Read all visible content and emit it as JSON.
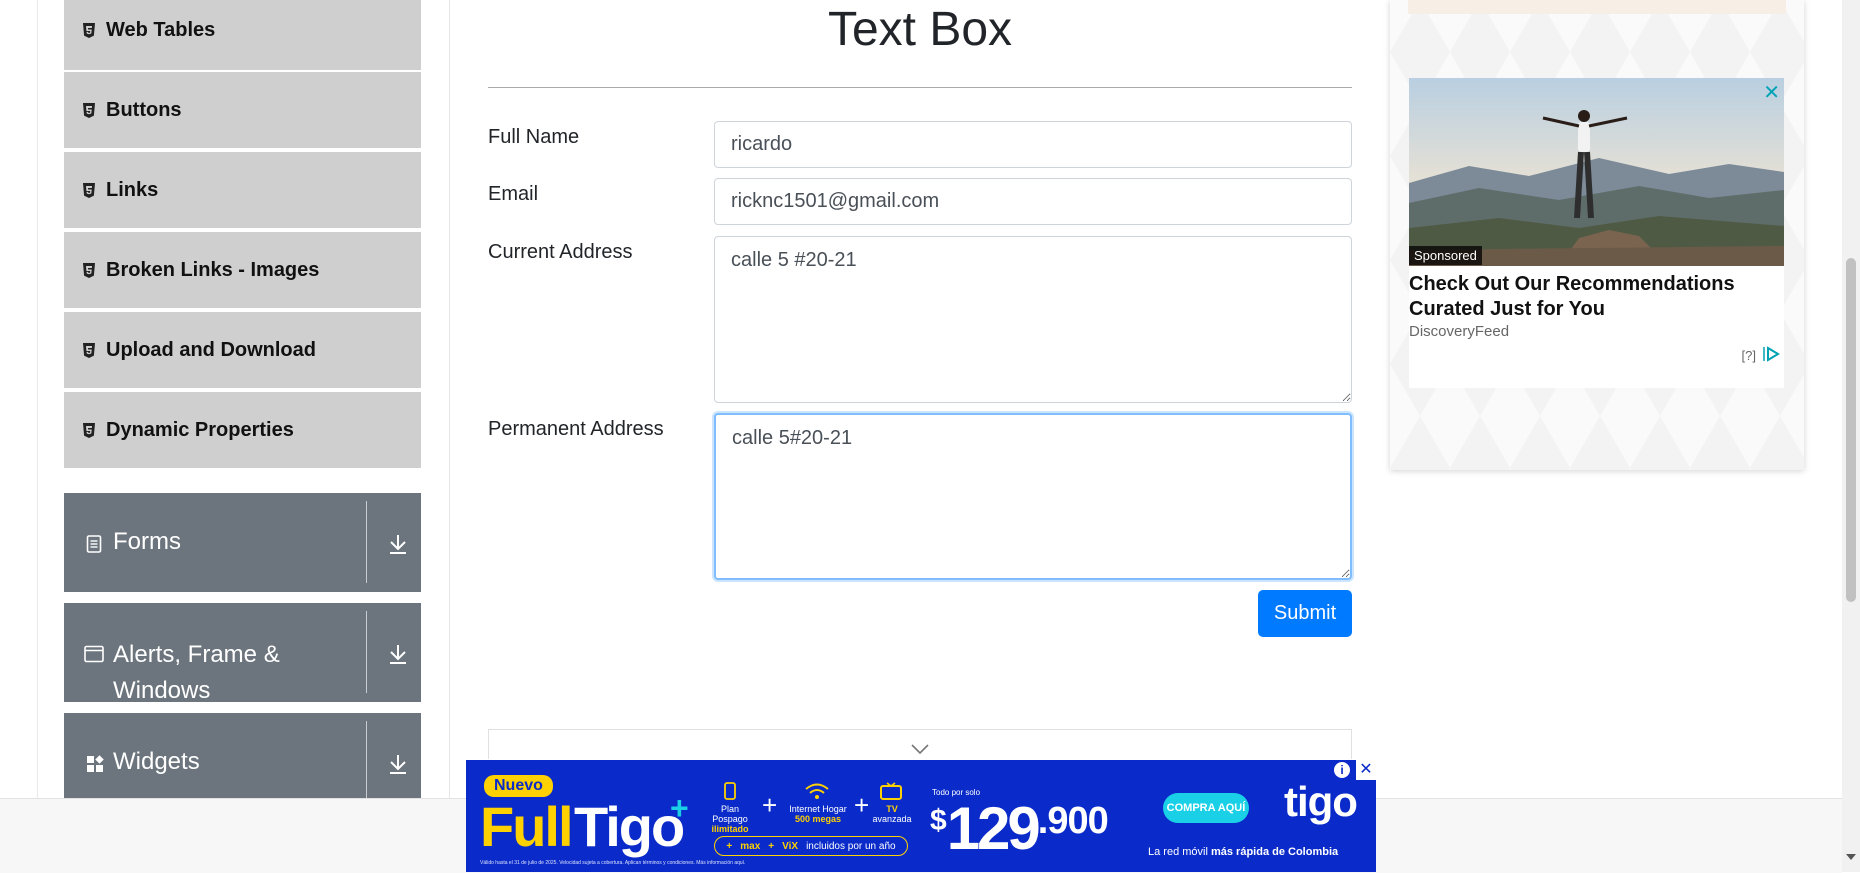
{
  "sidebar": {
    "sub_items": [
      {
        "label": "Web Tables"
      },
      {
        "label": "Buttons"
      },
      {
        "label": "Links"
      },
      {
        "label": "Broken Links - Images"
      },
      {
        "label": "Upload and Download"
      },
      {
        "label": "Dynamic Properties"
      }
    ],
    "groups": [
      {
        "label": "Forms",
        "icon": "document-icon"
      },
      {
        "label_line1": "Alerts, Frame &",
        "label_line2": "Windows",
        "icon": "window-icon"
      },
      {
        "label": "Widgets",
        "icon": "widgets-icon"
      }
    ]
  },
  "main": {
    "title": "Text Box",
    "fields": {
      "full_name": {
        "label": "Full Name",
        "value": "ricardo"
      },
      "email": {
        "label": "Email",
        "value": "ricknc1501@gmail.com"
      },
      "current_address": {
        "label": "Current Address",
        "value": "calle 5 #20-21"
      },
      "permanent_address": {
        "label": "Permanent Address",
        "value": "calle 5#20-21"
      }
    },
    "submit_label": "Submit"
  },
  "right_ad": {
    "sponsored": "Sponsored",
    "headline": "Check Out Our Recommendations Curated Just for You",
    "source": "DiscoveryFeed",
    "info": "[?]",
    "close": "✕"
  },
  "bottom_ad": {
    "badge": "Nuevo",
    "brand_full": "Full",
    "brand_tigo": "Tigo",
    "plus": "+",
    "feature1_line1": "Plan Pospago",
    "feature1_line2": "ilimitado",
    "feature2_line1": "Internet Hogar",
    "feature2_line2": "500 megas",
    "feature3_line1": "TV",
    "feature3_line2": "avanzada",
    "strip_max": "max",
    "strip_vix": "ViX",
    "strip_text": "incluidos por un año",
    "price_prefix": "Todo por solo",
    "price_currency": "$",
    "price_main": "129",
    "price_cents": ".900",
    "cta": "COMPRA AQUÍ",
    "logo": "tigo",
    "tagline_pre": "La red móvil",
    "tagline_bold": "más rápida de Colombia",
    "legal": "Válido hasta el 31 de julio de 2025. Velocidad sujeta a cobertura. Aplican términos y condiciones. Más información aquí.",
    "close": "✕",
    "info": "i"
  },
  "colors": {
    "submit": "#007bff",
    "group_bg": "#6c757d",
    "sub_item_bg": "#cfcfcf",
    "ad_blue": "#0a2bc9",
    "ad_yellow": "#ffd100",
    "focus_border": "#80bdff"
  }
}
